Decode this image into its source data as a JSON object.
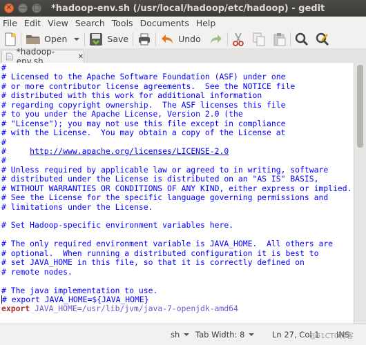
{
  "window": {
    "title": "*hadoop-env.sh (/usr/local/hadoop/etc/hadoop) - gedit",
    "close_glyph": "✕",
    "min_glyph": "—",
    "max_glyph": "□"
  },
  "menu": [
    "File",
    "Edit",
    "View",
    "Search",
    "Tools",
    "Documents",
    "Help"
  ],
  "toolbar": {
    "open_label": "Open",
    "save_label": "Save",
    "undo_label": "Undo"
  },
  "tab": {
    "label": "*hadoop-env.sh",
    "close_glyph": "✕"
  },
  "editor": {
    "lines": [
      {
        "type": "comment",
        "text": "#"
      },
      {
        "type": "comment",
        "text": "# Licensed to the Apache Software Foundation (ASF) under one"
      },
      {
        "type": "comment",
        "text": "# or more contributor license agreements.  See the NOTICE file"
      },
      {
        "type": "comment",
        "text": "# distributed with this work for additional information"
      },
      {
        "type": "comment",
        "text": "# regarding copyright ownership.  The ASF licenses this file"
      },
      {
        "type": "comment",
        "text": "# to you under the Apache License, Version 2.0 (the"
      },
      {
        "type": "comment",
        "text": "# \"License\"); you may not use this file except in compliance"
      },
      {
        "type": "comment",
        "text": "# with the License.  You may obtain a copy of the License at"
      },
      {
        "type": "comment",
        "text": "#"
      },
      {
        "type": "url",
        "prefix": "#     ",
        "text": "http://www.apache.org/licenses/LICENSE-2.0"
      },
      {
        "type": "comment",
        "text": "#"
      },
      {
        "type": "comment",
        "text": "# Unless required by applicable law or agreed to in writing, software"
      },
      {
        "type": "comment",
        "text": "# distributed under the License is distributed on an \"AS IS\" BASIS,"
      },
      {
        "type": "comment",
        "text": "# WITHOUT WARRANTIES OR CONDITIONS OF ANY KIND, either express or implied."
      },
      {
        "type": "comment",
        "text": "# See the License for the specific language governing permissions and"
      },
      {
        "type": "comment",
        "text": "# limitations under the License."
      },
      {
        "type": "blank",
        "text": ""
      },
      {
        "type": "comment",
        "text": "# Set Hadoop-specific environment variables here."
      },
      {
        "type": "blank",
        "text": ""
      },
      {
        "type": "comment",
        "text": "# The only required environment variable is JAVA_HOME.  All others are"
      },
      {
        "type": "comment",
        "text": "# optional.  When running a distributed configuration it is best to"
      },
      {
        "type": "comment",
        "text": "# set JAVA_HOME in this file, so that it is correctly defined on"
      },
      {
        "type": "comment",
        "text": "# remote nodes."
      },
      {
        "type": "blank",
        "text": ""
      },
      {
        "type": "comment",
        "text": "# The java implementation to use."
      },
      {
        "type": "cursor",
        "text": "# export JAVA_HOME=${JAVA_HOME}"
      },
      {
        "type": "export",
        "keyword": "export",
        "text": " JAVA_HOME=/usr/lib/jvm/java-7-openjdk-amd64"
      }
    ]
  },
  "statusbar": {
    "language": "sh",
    "tab_width": "Tab Width: 8",
    "position": "Ln 27, Col 1",
    "mode": "INS"
  },
  "watermark": "@51CTO博客",
  "colors": {
    "titlebar": "#3c3b37",
    "comment": "#0000ff",
    "keyword": "#a52a2a",
    "plain": "#6a5acd"
  }
}
